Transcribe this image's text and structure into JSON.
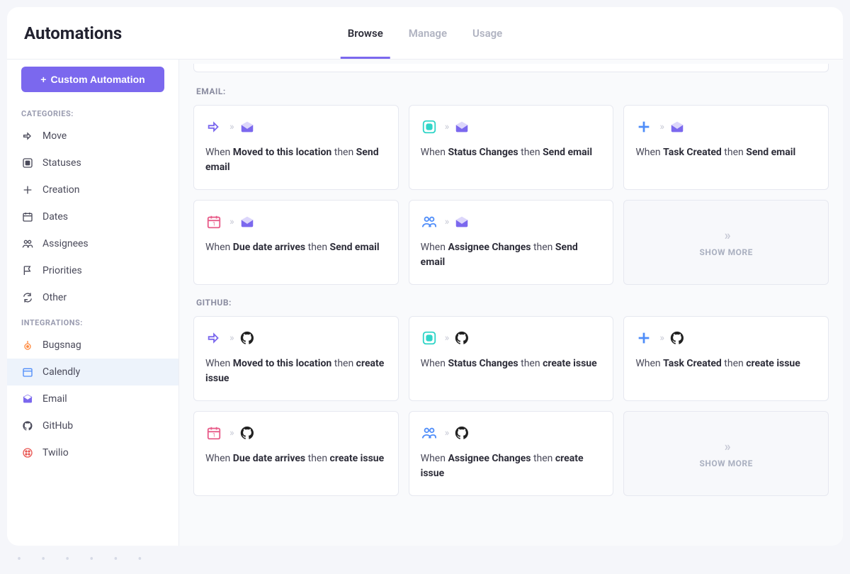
{
  "title": "Automations",
  "tabs": [
    {
      "label": "Browse",
      "active": true
    },
    {
      "label": "Manage",
      "active": false
    },
    {
      "label": "Usage",
      "active": false
    }
  ],
  "customButton": "Custom Automation",
  "categoriesHeader": "CATEGORIES:",
  "categories": [
    {
      "label": "Move",
      "icon": "arrow"
    },
    {
      "label": "Statuses",
      "icon": "square"
    },
    {
      "label": "Creation",
      "icon": "plus"
    },
    {
      "label": "Dates",
      "icon": "calendar"
    },
    {
      "label": "Assignees",
      "icon": "people"
    },
    {
      "label": "Priorities",
      "icon": "flag"
    },
    {
      "label": "Other",
      "icon": "refresh"
    }
  ],
  "integrationsHeader": "INTEGRATIONS:",
  "integrations": [
    {
      "label": "Bugsnag",
      "icon": "bugsnag",
      "active": false
    },
    {
      "label": "Calendly",
      "icon": "calendly",
      "active": true
    },
    {
      "label": "Email",
      "icon": "email",
      "active": false
    },
    {
      "label": "GitHub",
      "icon": "github",
      "active": false
    },
    {
      "label": "Twilio",
      "icon": "twilio",
      "active": false
    }
  ],
  "groups": [
    {
      "label": "EMAIL:",
      "moreLabel": "SHOW MORE",
      "cards": [
        {
          "trigger": "Moved to this location",
          "action": "Send email",
          "triggerIcon": "arrow",
          "actionIcon": "email"
        },
        {
          "trigger": "Status Changes",
          "action": "Send email",
          "triggerIcon": "status",
          "actionIcon": "email"
        },
        {
          "trigger": "Task Created",
          "action": "Send email",
          "triggerIcon": "plus",
          "actionIcon": "email"
        },
        {
          "trigger": "Due date arrives",
          "action": "Send email",
          "triggerIcon": "calendar",
          "actionIcon": "email"
        },
        {
          "trigger": "Assignee Changes",
          "action": "Send email",
          "triggerIcon": "people",
          "actionIcon": "email"
        }
      ]
    },
    {
      "label": "GITHUB:",
      "moreLabel": "SHOW MORE",
      "cards": [
        {
          "trigger": "Moved to this location",
          "action": "create issue",
          "triggerIcon": "arrow",
          "actionIcon": "github"
        },
        {
          "trigger": "Status Changes",
          "action": "create issue",
          "triggerIcon": "status",
          "actionIcon": "github"
        },
        {
          "trigger": "Task Created",
          "action": "create issue",
          "triggerIcon": "plus",
          "actionIcon": "github"
        },
        {
          "trigger": "Due date arrives",
          "action": "create issue",
          "triggerIcon": "calendar",
          "actionIcon": "github"
        },
        {
          "trigger": "Assignee Changes",
          "action": "create issue",
          "triggerIcon": "people",
          "actionIcon": "github"
        }
      ]
    }
  ],
  "whenWord": "When",
  "thenWord": "then"
}
